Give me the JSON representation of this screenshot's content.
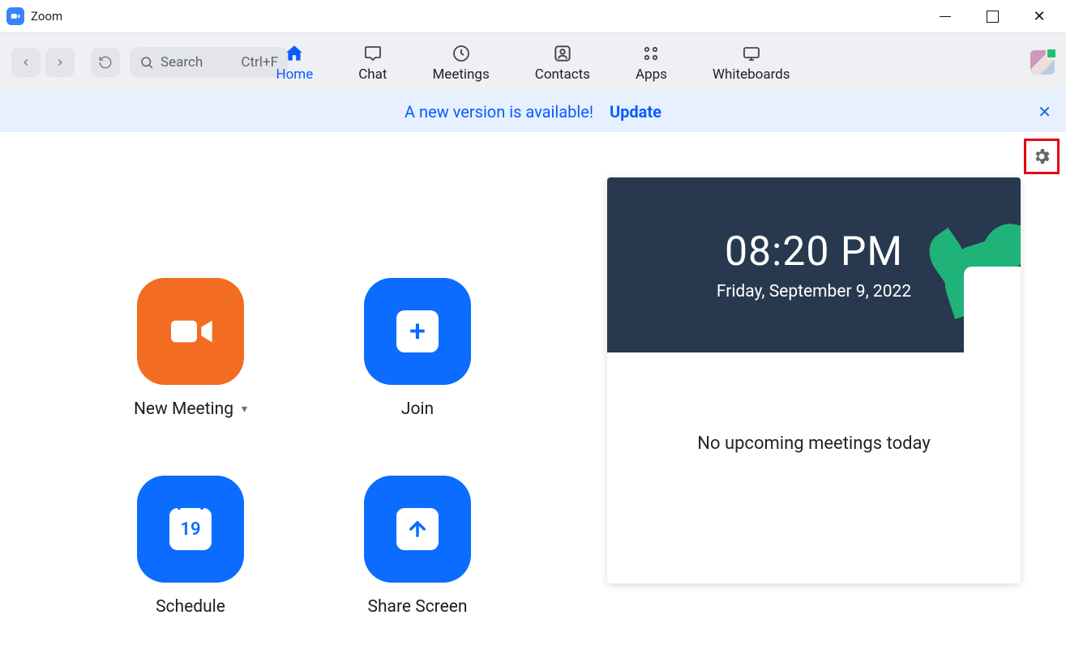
{
  "window": {
    "title": "Zoom"
  },
  "toolbar": {
    "search_placeholder": "Search",
    "search_shortcut": "Ctrl+F",
    "tabs": [
      {
        "label": "Home",
        "active": true
      },
      {
        "label": "Chat"
      },
      {
        "label": "Meetings"
      },
      {
        "label": "Contacts"
      },
      {
        "label": "Apps"
      },
      {
        "label": "Whiteboards"
      }
    ]
  },
  "banner": {
    "message": "A new version is available!",
    "action": "Update"
  },
  "actions": {
    "new_meeting": "New Meeting",
    "join": "Join",
    "schedule": "Schedule",
    "schedule_day": "19",
    "share_screen": "Share Screen"
  },
  "clock": {
    "time": "08:20 PM",
    "date": "Friday, September 9, 2022"
  },
  "meetings_empty": "No upcoming meetings today"
}
